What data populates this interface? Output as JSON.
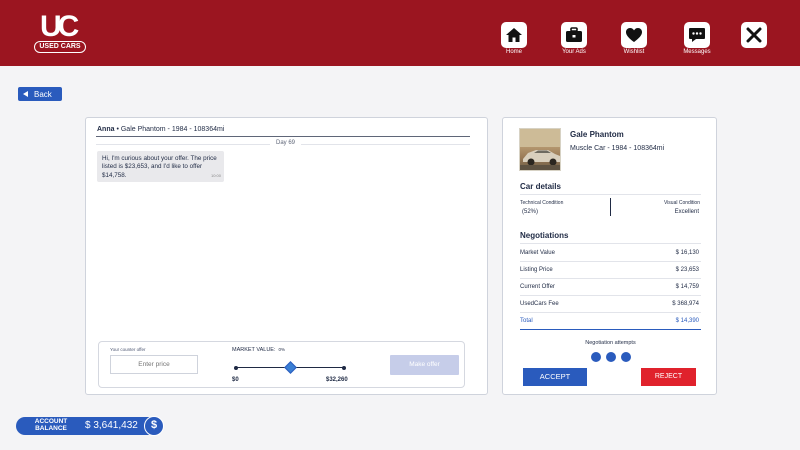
{
  "app": {
    "logo_letters": "UC",
    "logo_text": "USED CARS"
  },
  "nav": [
    {
      "label": "Home",
      "icon": "home-icon"
    },
    {
      "label": "Your Ads",
      "icon": "briefcase-icon"
    },
    {
      "label": "Wishlist",
      "icon": "heart-icon"
    },
    {
      "label": "Messages",
      "icon": "chat-icon"
    }
  ],
  "back_label": "Back",
  "chat": {
    "buyer": "Anna",
    "separator": "•",
    "listing": "Gale Phantom - 1984 - 108364mi",
    "day": "Day 69",
    "message": {
      "text": "Hi, I'm curious about your offer. The price listed is $23,653, and I'd like to offer $14,758.",
      "time": "10:00"
    },
    "counter": {
      "label": "Your counter offer",
      "placeholder": "Enter price",
      "market_value_label": "MARKET VALUE:",
      "market_value_pct": "0%",
      "slider_fraction": 0.5,
      "min": "$0",
      "max": "$32,260",
      "button": "Make offer"
    }
  },
  "car": {
    "name": "Gale Phantom",
    "subtitle": "Muscle Car - 1984 - 108364mi",
    "details_title": "Car details",
    "technical_label": "Technical Condition",
    "technical_value": "(52%)",
    "visual_label": "Visual Condition",
    "visual_value": "Excellent",
    "negotiations_title": "Negotiations",
    "rows": [
      {
        "key": "Market Value",
        "value": "$ 16,130"
      },
      {
        "key": "Listing Price",
        "value": "$ 23,653"
      },
      {
        "key": "Current Offer",
        "value": "$ 14,759"
      },
      {
        "key": "UsedCars Fee",
        "value": "$ 368,974"
      },
      {
        "key": "Total",
        "value": "$ 14,390"
      }
    ],
    "attempts_label": "Negotiation attempts",
    "attempts_remaining": 3,
    "accept": "ACCEPT",
    "reject": "REJECT"
  },
  "balance": {
    "label_line1": "ACCOUNT",
    "label_line2": "BALANCE",
    "value": "$ 3,641,432",
    "badge": "$"
  },
  "colors": {
    "header": "#9b1520",
    "primary": "#2a5bbd",
    "reject": "#e0222c"
  }
}
